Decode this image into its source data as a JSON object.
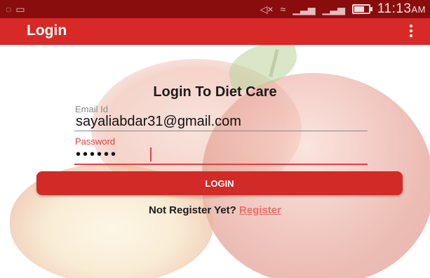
{
  "status_bar": {
    "time": "11:13",
    "ampm": "AM",
    "icons": [
      "notification-icon",
      "message-icon",
      "mute-icon",
      "wifi-icon",
      "signal-1-icon",
      "signal-2-icon",
      "battery-icon"
    ],
    "battery_level": 0.8
  },
  "app_bar": {
    "title": "Login",
    "menu_icon": "more-vert-icon"
  },
  "form": {
    "heading": "Login To Diet Care",
    "email_label": "Email Id",
    "email_value": "sayaliabdar31@gmail.com",
    "password_label": "Password",
    "password_value": "••••••",
    "login_button": "LOGIN",
    "register_prompt": "Not Register Yet?",
    "register_link": "Register"
  },
  "colors": {
    "status_bar": "#8a0d0d",
    "app_bar": "#d72a26",
    "accent": "#e0433c",
    "button": "#d22a26",
    "link": "#e9716b"
  }
}
